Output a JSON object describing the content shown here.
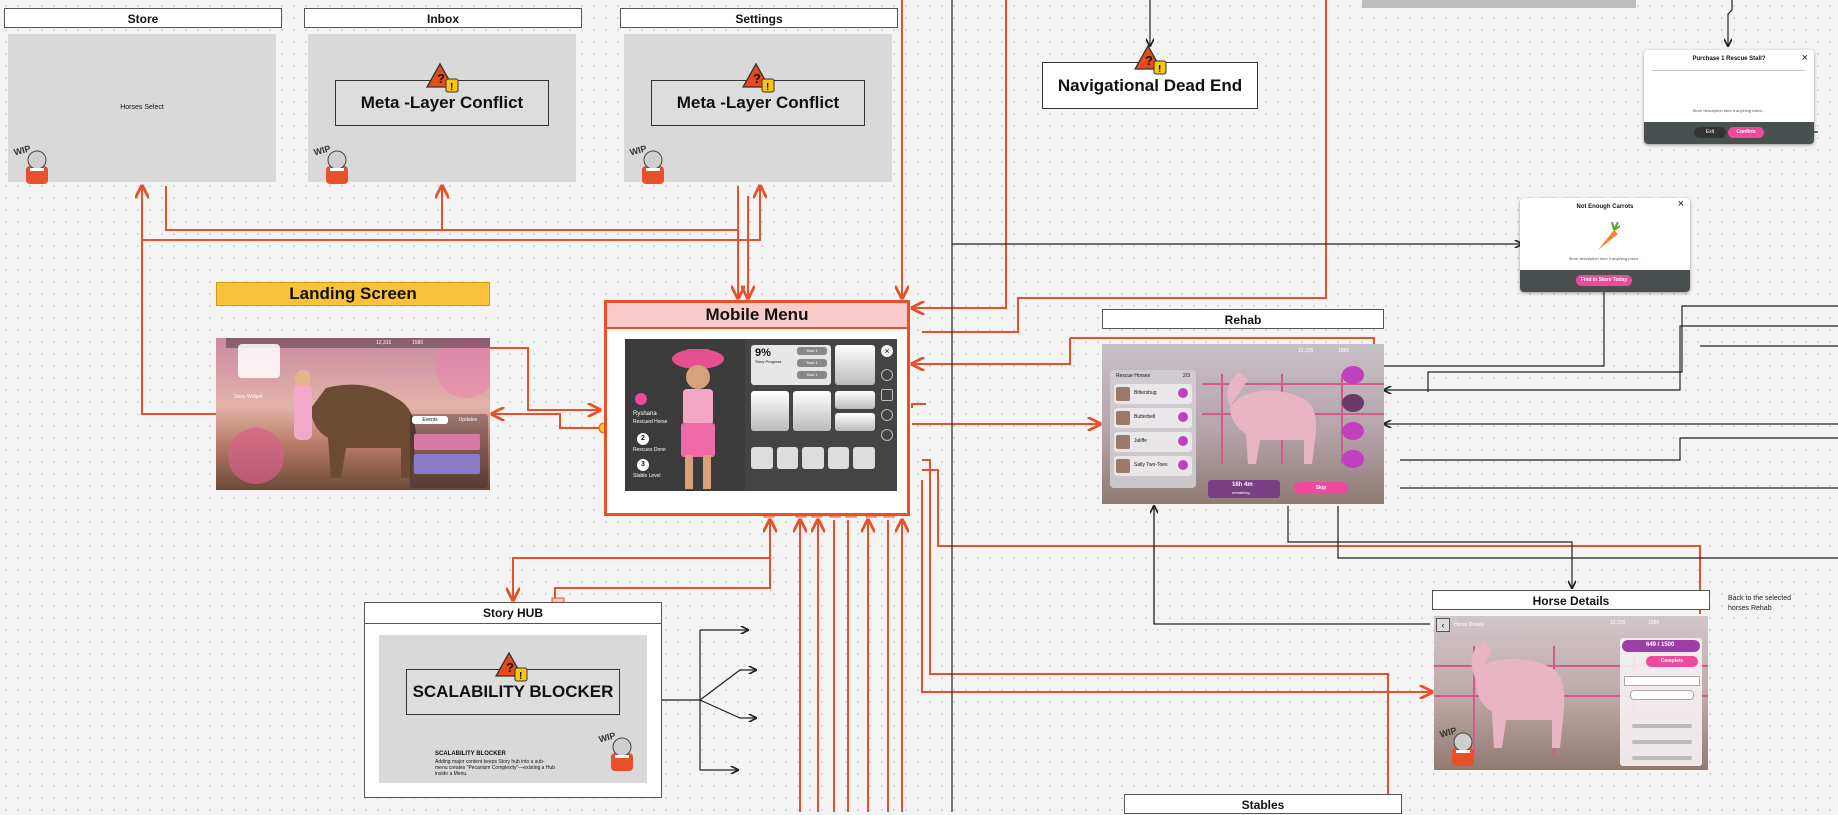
{
  "nodes": {
    "store": {
      "label": "Store",
      "panel_text": "Horses Select"
    },
    "inbox": {
      "label": "Inbox",
      "warning": "Meta -Layer Conflict"
    },
    "settings": {
      "label": "Settings",
      "warning": "Meta -Layer Conflict"
    },
    "dead_end": {
      "warning": "Navigational Dead End"
    },
    "landing": {
      "label": "Landing Screen",
      "widget": "Story Widget",
      "tab_events": "Events",
      "tab_updates": "Updates",
      "currency": "12,315",
      "gems": "1580"
    },
    "mobile_menu": {
      "label": "Mobile Menu",
      "percent": "9%",
      "story_progress": "Story Progress",
      "task1": "Task 1",
      "task2": "Task 1",
      "task3": "Task 1",
      "player_name": "Ryshana",
      "player_sub": "Rescued Horse",
      "stat1_value": "2",
      "stat1_label": "Rescues Done",
      "stat2_value": "3",
      "stat2_label": "Stable Level"
    },
    "story_hub": {
      "label": "Story HUB",
      "warning": "SCALABILITY BLOCKER",
      "note_title": "SCALABILITY BLOCKER",
      "note_body": "Adding major content keeps Story hub into a sub-menu creates \"Pecanism Complexity\"—existing a Hub inside a Menu."
    },
    "rehab": {
      "label": "Rehab",
      "list_header": "Rescue Horses",
      "list_count": "2/3",
      "horses": [
        "Bittersbug",
        "Butterbell",
        "Juliffe",
        "Sally Two-Toes"
      ],
      "timer": "16h 4m",
      "timer_sub": "remaining",
      "skip": "Skip",
      "currency": "12,315",
      "gems": "1580"
    },
    "horse_details": {
      "label": "Horse Details",
      "title": "Horse Details",
      "progress": "649 / 1500",
      "complete": "Complete",
      "currency": "12,315",
      "gems": "1580",
      "note": "Back to the selected horses Rehab"
    },
    "popup_purchase": {
      "title": "Purchase 1 Rescue Stall?",
      "desc": "Store description here if anything token...",
      "cancel": "Exit",
      "confirm": "Confirm"
    },
    "popup_carrots": {
      "title": "Not Enough Carrots",
      "desc": "Store description here if anything token...",
      "button": "Find in Store Today"
    },
    "stables": {
      "label": "Stables"
    },
    "wip": "WIP"
  },
  "colors": {
    "accent_orange": "#e8502a",
    "landing_yellow": "#fbc13b",
    "pink": "#ee4a9d",
    "warn_red": "#e84b1a",
    "warn_yellow": "#f7c60f"
  }
}
